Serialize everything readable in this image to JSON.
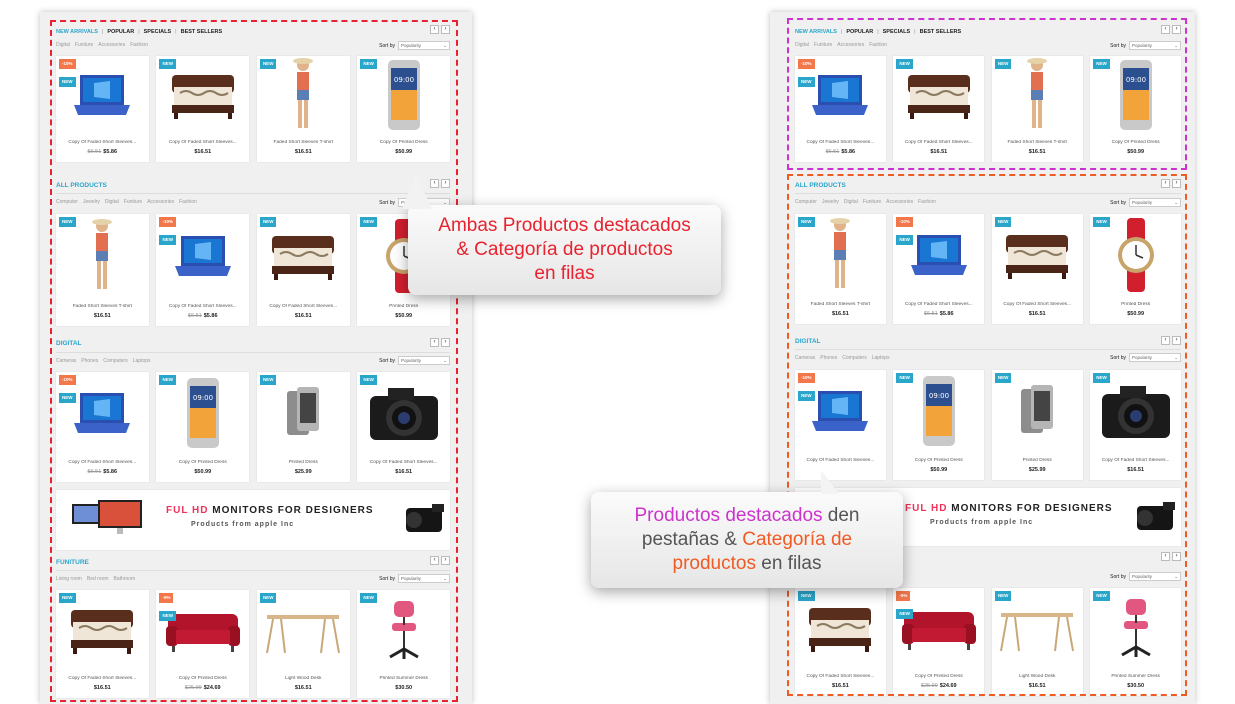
{
  "colors": {
    "accent": "#2ba6cb",
    "sale": "#f2774b",
    "callout_red": "#e8232f",
    "callout_magenta": "#cc33cc",
    "callout_orange": "#f05a23"
  },
  "left": {
    "tabs": [
      "NEW ARRIVALS",
      "POPULAR",
      "SPECIALS",
      "BEST SELLERS"
    ],
    "tabs_cats": [
      "Digital",
      "Funiture",
      "Accessories",
      "Fashion"
    ],
    "sort_label": "Sort by",
    "sort_value": "Popularity",
    "row1": [
      {
        "badge": "-10%",
        "badge2": "NEW",
        "img": "laptop-icon",
        "name": "Copy Of Faded Short Sleeves...",
        "old": "$6.51",
        "price": "$5.86"
      },
      {
        "badge": "NEW",
        "img": "bed-icon",
        "name": "Copy Of Faded Short Sleeves...",
        "old": "",
        "price": "$16.51"
      },
      {
        "badge": "NEW",
        "img": "woman-icon",
        "name": "Faded Short Sleeves T-shirt",
        "old": "",
        "price": "$16.51"
      },
      {
        "badge": "NEW",
        "img": "phone-icon",
        "name": "Copy Of Printed Dress",
        "old": "",
        "price": "$50.99"
      }
    ],
    "all_title": "ALL PRODUCTS",
    "all_cats": [
      "Computer",
      "Jewelry",
      "Digital",
      "Funiture",
      "Accessories",
      "Fashion"
    ],
    "row2": [
      {
        "badge": "NEW",
        "img": "woman-icon",
        "name": "Faded Short Sleeves T-shirt",
        "old": "",
        "price": "$16.51"
      },
      {
        "badge": "-10%",
        "badge2": "NEW",
        "img": "laptop-icon",
        "name": "Copy Of Faded Short Sleeves...",
        "old": "$6.51",
        "price": "$5.86"
      },
      {
        "badge": "NEW",
        "img": "bed-icon",
        "name": "Copy Of Faded Short Sleeves...",
        "old": "",
        "price": "$16.51"
      },
      {
        "badge": "NEW",
        "img": "watch-icon",
        "name": "Printed Dress",
        "old": "",
        "price": "$50.99"
      }
    ],
    "digital_title": "DIGITAL",
    "digital_cats": [
      "Cameras",
      "Phones",
      "Computers",
      "Laptops"
    ],
    "row3": [
      {
        "badge": "-10%",
        "badge2": "NEW",
        "img": "laptop-icon",
        "name": "Copy Of Faded Short Sleeves...",
        "old": "$6.51",
        "price": "$5.86"
      },
      {
        "badge": "NEW",
        "img": "phone-icon",
        "name": "Copy Of Printed Dress",
        "old": "",
        "price": "$50.99"
      },
      {
        "badge": "NEW",
        "img": "smartphone-icon",
        "name": "Printed Dress",
        "old": "",
        "price": "$25.99"
      },
      {
        "badge": "NEW",
        "img": "camera-icon",
        "name": "Copy Of Faded Short Sleeves...",
        "old": "",
        "price": "$16.51"
      }
    ],
    "banner_hl": "FUL HD",
    "banner_rest": "MONITORS FOR DESIGNERS",
    "banner_sub": "Products from apple Inc",
    "fun_title": "FUNITURE",
    "fun_cats": [
      "Living room",
      "Bed room",
      "Bathroom"
    ],
    "row4": [
      {
        "badge": "NEW",
        "img": "bed-icon",
        "name": "Copy Of Faded Short Sleeves...",
        "old": "",
        "price": "$16.51"
      },
      {
        "badge": "-5%",
        "badge2": "NEW",
        "img": "sofa-icon",
        "name": "Copy Of Printed Dress",
        "old": "$25.99",
        "price": "$24.69"
      },
      {
        "badge": "NEW",
        "img": "desk-icon",
        "name": "Light Wood Desk",
        "old": "",
        "price": "$16.51"
      },
      {
        "badge": "NEW",
        "img": "chair-icon",
        "name": "Printed Summer Dress",
        "old": "",
        "price": "$30.50"
      }
    ]
  },
  "right": {
    "row2": [
      {
        "badge": "NEW",
        "img": "woman-icon",
        "name": "Faded Short Sleeves T-shirt",
        "old": "",
        "price": "$16.51"
      },
      {
        "badge": "-10%",
        "badge2": "NEW",
        "img": "laptop-icon",
        "name": "Copy Of Faded Short Sleeves...",
        "old": "$6.51",
        "price": "$5.86"
      },
      {
        "badge": "NEW",
        "img": "bed-icon",
        "name": "Copy Of Faded Short Sleeves...",
        "old": "",
        "price": "$16.51"
      },
      {
        "badge": "NEW",
        "img": "watch-icon",
        "name": "Printed Dress",
        "old": "",
        "price": "$50.99"
      }
    ],
    "row3": [
      {
        "badge": "-10%",
        "badge2": "NEW",
        "img": "laptop-icon",
        "name": "Copy Of Faded Short Sleeves...",
        "old": "",
        "price": ""
      },
      {
        "badge": "NEW",
        "img": "phone-icon",
        "name": "Copy Of Printed Dress",
        "old": "",
        "price": "$50.99"
      },
      {
        "badge": "NEW",
        "img": "smartphone-icon",
        "name": "Printed Dress",
        "old": "",
        "price": "$25.99"
      },
      {
        "badge": "NEW",
        "img": "camera-icon",
        "name": "Copy Of Faded Short Sleeves...",
        "old": "",
        "price": "$16.51"
      }
    ]
  },
  "callout1": {
    "line1": "Ambas Productos destacados",
    "line2": "& Categoría de productos",
    "line3": "en filas"
  },
  "callout2": {
    "a": "Productos destacados",
    "b": " den",
    "c": "pestañas & ",
    "d": "Categoría de",
    "e": "productos",
    "f": " en filas"
  },
  "arrow_left": "‹",
  "arrow_right": "›",
  "select_caret": "⌄"
}
